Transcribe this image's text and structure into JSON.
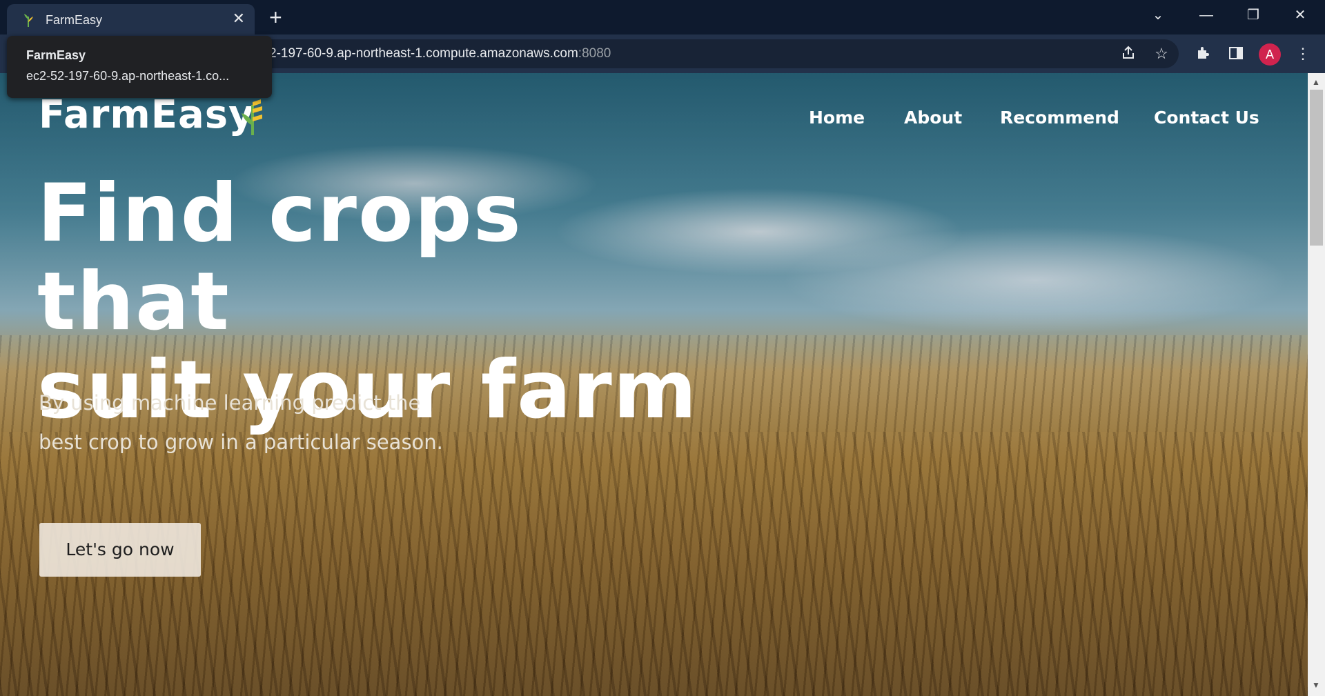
{
  "browser": {
    "tab_title": "FarmEasy",
    "tab_close": "✕",
    "new_tab": "+",
    "url_main": "2-197-60-9.ap-northeast-1.compute.amazonaws.com",
    "url_port": ":8080",
    "tooltip_title": "FarmEasy",
    "tooltip_url": "ec2-52-197-60-9.ap-northeast-1.co...",
    "profile_initial": "A",
    "window_controls": {
      "dropdown": "⌄",
      "minimize": "—",
      "restore": "❐",
      "close": "✕"
    },
    "icons": [
      "share-icon",
      "star-icon",
      "extensions-icon",
      "sidepanel-icon",
      "menu-icon"
    ]
  },
  "site": {
    "logo": "FarmEasy",
    "nav": [
      "Home",
      "About",
      "Recommend",
      "Contact Us"
    ],
    "hero_title_line1": "Find crops that",
    "hero_title_line2": "suit your farm",
    "hero_sub_line1": "By using machine learning predict the",
    "hero_sub_line2": "best crop to grow in a particular season.",
    "cta": "Let's go now"
  },
  "colors": {
    "accent_logo_green": "#6ab04c",
    "accent_logo_yellow": "#f2c230",
    "profile": "#d0234e"
  }
}
